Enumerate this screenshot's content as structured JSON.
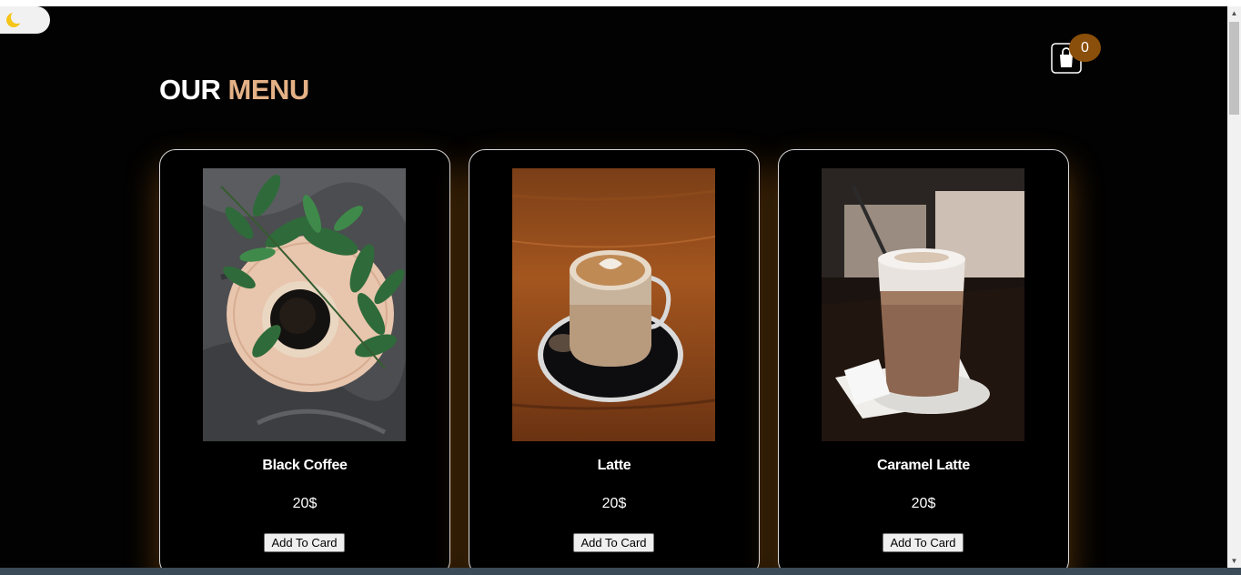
{
  "header": {
    "title_first": "OUR",
    "title_accent": "MENU",
    "cart_count": "0"
  },
  "menu_items": [
    {
      "name": "Black Coffee",
      "price": "20$",
      "button_label": "Add To Card"
    },
    {
      "name": "Latte",
      "price": "20$",
      "button_label": "Add To Card"
    },
    {
      "name": "Caramel Latte",
      "price": "20$",
      "button_label": "Add To Card"
    }
  ],
  "icons": {
    "theme_toggle": "moon-icon",
    "cart": "shopping-bag-icon"
  },
  "colors": {
    "background": "#020202",
    "accent": "#e4b186",
    "badge": "#8a4f0a",
    "card_glow": "#be6e14",
    "moon": "#f5c518"
  }
}
